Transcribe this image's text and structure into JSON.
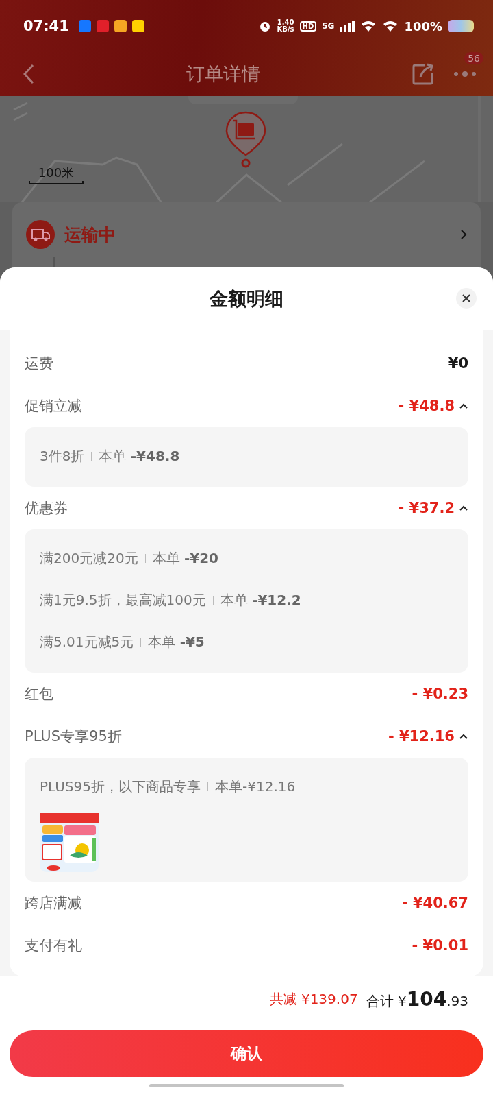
{
  "status_bar": {
    "time": "07:41",
    "speed_value": "1.40",
    "speed_unit": "KB/s",
    "hd": "HD",
    "network": "5G",
    "battery": "100%"
  },
  "header": {
    "title": "订单详情",
    "badge": "56"
  },
  "map": {
    "scale": "100米"
  },
  "shipment": {
    "status": "运输中"
  },
  "sheet": {
    "title": "金额明细",
    "rows": [
      {
        "label": "运费",
        "amount": "¥0",
        "kind": "fee"
      },
      {
        "label": "促销立减",
        "amount": "- ¥48.8",
        "kind": "discount",
        "expanded": true,
        "details": [
          {
            "name": "3件8折",
            "amount": "本单 **-¥48.8**"
          }
        ]
      },
      {
        "label": "优惠券",
        "amount": "- ¥37.2",
        "kind": "discount",
        "expanded": true,
        "details": [
          {
            "name": "满200元减20元",
            "amount": "本单 **-¥20**"
          },
          {
            "name": "满1元9.5折，最高减100元",
            "amount": "本单 **-¥12.2**"
          },
          {
            "name": "满5.01元减5元",
            "amount": "本单 **-¥5**"
          }
        ]
      },
      {
        "label": "红包",
        "amount": "- ¥0.23",
        "kind": "discount"
      },
      {
        "label": "PLUS专享95折",
        "amount": "- ¥12.16",
        "kind": "discount",
        "expanded": true,
        "details": [
          {
            "name": "PLUS95折，以下商品专享",
            "amount": "本单-¥12.16"
          }
        ]
      },
      {
        "label": "跨店满减",
        "amount": "- ¥40.67",
        "kind": "discount"
      },
      {
        "label": "支付有礼",
        "amount": "- ¥0.01",
        "kind": "discount"
      }
    ]
  },
  "footer": {
    "saved_label": "共减",
    "saved": "¥139.07",
    "total_label": "合计",
    "currency": "¥",
    "total_int": "104",
    "total_dec": ".93",
    "confirm": "确认"
  }
}
